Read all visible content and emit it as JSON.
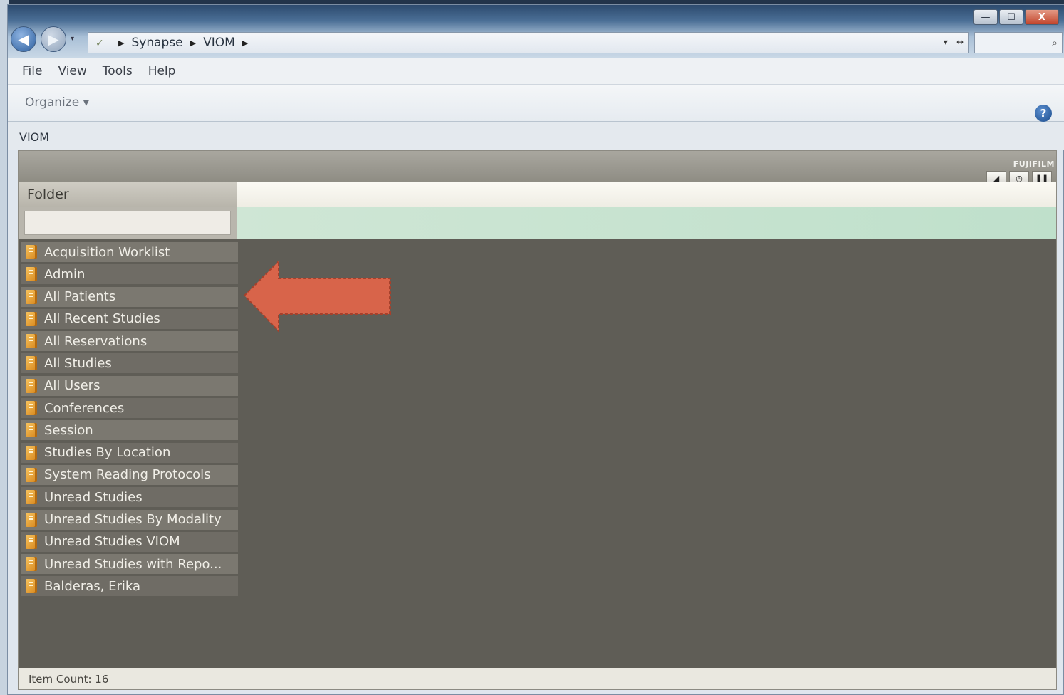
{
  "address": {
    "crumbs": [
      "Synapse",
      "VIOM"
    ]
  },
  "window_controls": {
    "minimize": "—",
    "maximize": "☐",
    "close": "X"
  },
  "menu": [
    "File",
    "View",
    "Tools",
    "Help"
  ],
  "toolbar": {
    "organize_label": "Organize ▾",
    "help_icon": "?"
  },
  "content_title": "VIOM",
  "app": {
    "brand": "FUJIFILM",
    "folder_header": "Folder",
    "folders": [
      "Acquisition Worklist",
      "Admin",
      "All Patients",
      "All Recent Studies",
      "All Reservations",
      "All Studies",
      "All Users",
      "Conferences",
      "Session",
      "Studies By Location",
      "System Reading Protocols",
      "Unread Studies",
      "Unread Studies By Modality",
      "Unread Studies VIOM",
      "Unread Studies with Repo...",
      "Balderas, Erika"
    ],
    "status": "Item Count: 16"
  },
  "annotation": {
    "arrow_color": "#d8644a",
    "points_to": "All Patients"
  }
}
